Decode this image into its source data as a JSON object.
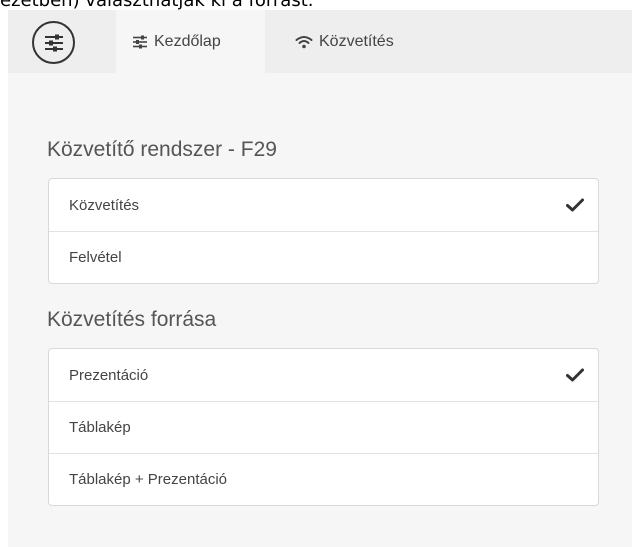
{
  "caption": "ezetben) választhatják ki a forrást.",
  "nav": {
    "menu_icon": "sliders-icon",
    "tabs": [
      {
        "label": "Kezdőlap",
        "icon": "sliders-icon",
        "active": true
      },
      {
        "label": "Közvetítés",
        "icon": "wifi-icon",
        "active": false
      }
    ]
  },
  "system": {
    "title": "Közvetítő rendszer - F29",
    "items": [
      {
        "label": "Közvetítés",
        "selected": true
      },
      {
        "label": "Felvétel",
        "selected": false
      }
    ]
  },
  "source": {
    "title": "Közvetítés forrása",
    "items": [
      {
        "label": "Prezentáció",
        "selected": true
      },
      {
        "label": "Táblakép",
        "selected": false
      },
      {
        "label": "Táblakép + Prezentáció",
        "selected": false
      }
    ]
  },
  "colors": {
    "text": "#444444",
    "heading": "#555555",
    "panel_bg": "#f6f6f6",
    "topbar_bg": "#eeeeee",
    "check": "#333333"
  }
}
